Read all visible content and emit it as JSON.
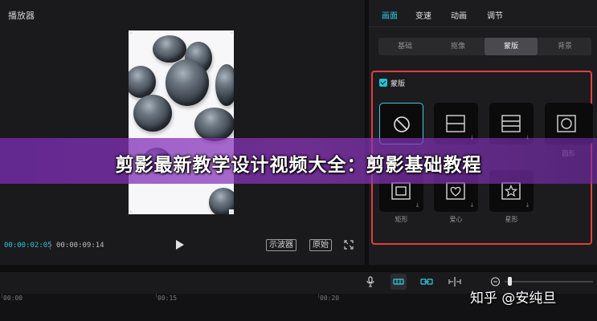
{
  "player": {
    "title": "播放器",
    "current_time": "00:00:02:05",
    "total_time": "00:00:09:14",
    "scope_button": "示波器",
    "original_button": "原始"
  },
  "right_panel": {
    "main_tabs": [
      {
        "label": "画面",
        "active": true
      },
      {
        "label": "变速",
        "active": false
      },
      {
        "label": "动画",
        "active": false
      },
      {
        "label": "调节",
        "active": false
      }
    ],
    "sub_tabs": [
      {
        "label": "基础",
        "active": false
      },
      {
        "label": "抠像",
        "active": false
      },
      {
        "label": "蒙版",
        "active": true
      },
      {
        "label": "背景",
        "active": false
      }
    ],
    "mask": {
      "checkbox_label": "蒙版",
      "checked": true,
      "options": [
        {
          "icon": "none-icon",
          "label": ""
        },
        {
          "icon": "linear-mask-icon",
          "label": ""
        },
        {
          "icon": "mirror-mask-icon",
          "label": ""
        },
        {
          "icon": "circle-mask-icon",
          "label": "圆形"
        },
        {
          "icon": "rectangle-mask-icon",
          "label": "矩形"
        },
        {
          "icon": "heart-mask-icon",
          "label": "爱心"
        },
        {
          "icon": "star-mask-icon",
          "label": "星形"
        }
      ]
    }
  },
  "banner": {
    "text": "剪影最新教学设计视频大全：剪影基础教程"
  },
  "timeline": {
    "ruler_labels": [
      "00:00",
      "00:15",
      "00:20"
    ]
  },
  "watermark": {
    "text": "知乎 @安纯旦"
  },
  "colors": {
    "accent": "#2ad1e3",
    "highlight_box": "#e0403e",
    "banner": "#8a3ac0"
  }
}
